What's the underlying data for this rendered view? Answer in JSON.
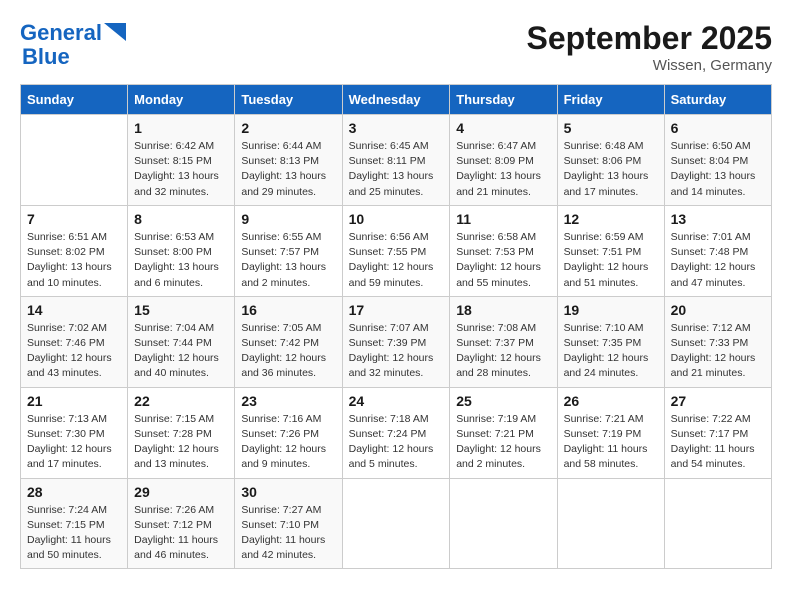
{
  "logo": {
    "line1": "General",
    "line2": "Blue"
  },
  "header": {
    "month": "September 2025",
    "location": "Wissen, Germany"
  },
  "days_of_week": [
    "Sunday",
    "Monday",
    "Tuesday",
    "Wednesday",
    "Thursday",
    "Friday",
    "Saturday"
  ],
  "weeks": [
    [
      {
        "num": "",
        "sunrise": "",
        "sunset": "",
        "daylight": ""
      },
      {
        "num": "1",
        "sunrise": "Sunrise: 6:42 AM",
        "sunset": "Sunset: 8:15 PM",
        "daylight": "Daylight: 13 hours and 32 minutes."
      },
      {
        "num": "2",
        "sunrise": "Sunrise: 6:44 AM",
        "sunset": "Sunset: 8:13 PM",
        "daylight": "Daylight: 13 hours and 29 minutes."
      },
      {
        "num": "3",
        "sunrise": "Sunrise: 6:45 AM",
        "sunset": "Sunset: 8:11 PM",
        "daylight": "Daylight: 13 hours and 25 minutes."
      },
      {
        "num": "4",
        "sunrise": "Sunrise: 6:47 AM",
        "sunset": "Sunset: 8:09 PM",
        "daylight": "Daylight: 13 hours and 21 minutes."
      },
      {
        "num": "5",
        "sunrise": "Sunrise: 6:48 AM",
        "sunset": "Sunset: 8:06 PM",
        "daylight": "Daylight: 13 hours and 17 minutes."
      },
      {
        "num": "6",
        "sunrise": "Sunrise: 6:50 AM",
        "sunset": "Sunset: 8:04 PM",
        "daylight": "Daylight: 13 hours and 14 minutes."
      }
    ],
    [
      {
        "num": "7",
        "sunrise": "Sunrise: 6:51 AM",
        "sunset": "Sunset: 8:02 PM",
        "daylight": "Daylight: 13 hours and 10 minutes."
      },
      {
        "num": "8",
        "sunrise": "Sunrise: 6:53 AM",
        "sunset": "Sunset: 8:00 PM",
        "daylight": "Daylight: 13 hours and 6 minutes."
      },
      {
        "num": "9",
        "sunrise": "Sunrise: 6:55 AM",
        "sunset": "Sunset: 7:57 PM",
        "daylight": "Daylight: 13 hours and 2 minutes."
      },
      {
        "num": "10",
        "sunrise": "Sunrise: 6:56 AM",
        "sunset": "Sunset: 7:55 PM",
        "daylight": "Daylight: 12 hours and 59 minutes."
      },
      {
        "num": "11",
        "sunrise": "Sunrise: 6:58 AM",
        "sunset": "Sunset: 7:53 PM",
        "daylight": "Daylight: 12 hours and 55 minutes."
      },
      {
        "num": "12",
        "sunrise": "Sunrise: 6:59 AM",
        "sunset": "Sunset: 7:51 PM",
        "daylight": "Daylight: 12 hours and 51 minutes."
      },
      {
        "num": "13",
        "sunrise": "Sunrise: 7:01 AM",
        "sunset": "Sunset: 7:48 PM",
        "daylight": "Daylight: 12 hours and 47 minutes."
      }
    ],
    [
      {
        "num": "14",
        "sunrise": "Sunrise: 7:02 AM",
        "sunset": "Sunset: 7:46 PM",
        "daylight": "Daylight: 12 hours and 43 minutes."
      },
      {
        "num": "15",
        "sunrise": "Sunrise: 7:04 AM",
        "sunset": "Sunset: 7:44 PM",
        "daylight": "Daylight: 12 hours and 40 minutes."
      },
      {
        "num": "16",
        "sunrise": "Sunrise: 7:05 AM",
        "sunset": "Sunset: 7:42 PM",
        "daylight": "Daylight: 12 hours and 36 minutes."
      },
      {
        "num": "17",
        "sunrise": "Sunrise: 7:07 AM",
        "sunset": "Sunset: 7:39 PM",
        "daylight": "Daylight: 12 hours and 32 minutes."
      },
      {
        "num": "18",
        "sunrise": "Sunrise: 7:08 AM",
        "sunset": "Sunset: 7:37 PM",
        "daylight": "Daylight: 12 hours and 28 minutes."
      },
      {
        "num": "19",
        "sunrise": "Sunrise: 7:10 AM",
        "sunset": "Sunset: 7:35 PM",
        "daylight": "Daylight: 12 hours and 24 minutes."
      },
      {
        "num": "20",
        "sunrise": "Sunrise: 7:12 AM",
        "sunset": "Sunset: 7:33 PM",
        "daylight": "Daylight: 12 hours and 21 minutes."
      }
    ],
    [
      {
        "num": "21",
        "sunrise": "Sunrise: 7:13 AM",
        "sunset": "Sunset: 7:30 PM",
        "daylight": "Daylight: 12 hours and 17 minutes."
      },
      {
        "num": "22",
        "sunrise": "Sunrise: 7:15 AM",
        "sunset": "Sunset: 7:28 PM",
        "daylight": "Daylight: 12 hours and 13 minutes."
      },
      {
        "num": "23",
        "sunrise": "Sunrise: 7:16 AM",
        "sunset": "Sunset: 7:26 PM",
        "daylight": "Daylight: 12 hours and 9 minutes."
      },
      {
        "num": "24",
        "sunrise": "Sunrise: 7:18 AM",
        "sunset": "Sunset: 7:24 PM",
        "daylight": "Daylight: 12 hours and 5 minutes."
      },
      {
        "num": "25",
        "sunrise": "Sunrise: 7:19 AM",
        "sunset": "Sunset: 7:21 PM",
        "daylight": "Daylight: 12 hours and 2 minutes."
      },
      {
        "num": "26",
        "sunrise": "Sunrise: 7:21 AM",
        "sunset": "Sunset: 7:19 PM",
        "daylight": "Daylight: 11 hours and 58 minutes."
      },
      {
        "num": "27",
        "sunrise": "Sunrise: 7:22 AM",
        "sunset": "Sunset: 7:17 PM",
        "daylight": "Daylight: 11 hours and 54 minutes."
      }
    ],
    [
      {
        "num": "28",
        "sunrise": "Sunrise: 7:24 AM",
        "sunset": "Sunset: 7:15 PM",
        "daylight": "Daylight: 11 hours and 50 minutes."
      },
      {
        "num": "29",
        "sunrise": "Sunrise: 7:26 AM",
        "sunset": "Sunset: 7:12 PM",
        "daylight": "Daylight: 11 hours and 46 minutes."
      },
      {
        "num": "30",
        "sunrise": "Sunrise: 7:27 AM",
        "sunset": "Sunset: 7:10 PM",
        "daylight": "Daylight: 11 hours and 42 minutes."
      },
      {
        "num": "",
        "sunrise": "",
        "sunset": "",
        "daylight": ""
      },
      {
        "num": "",
        "sunrise": "",
        "sunset": "",
        "daylight": ""
      },
      {
        "num": "",
        "sunrise": "",
        "sunset": "",
        "daylight": ""
      },
      {
        "num": "",
        "sunrise": "",
        "sunset": "",
        "daylight": ""
      }
    ]
  ]
}
